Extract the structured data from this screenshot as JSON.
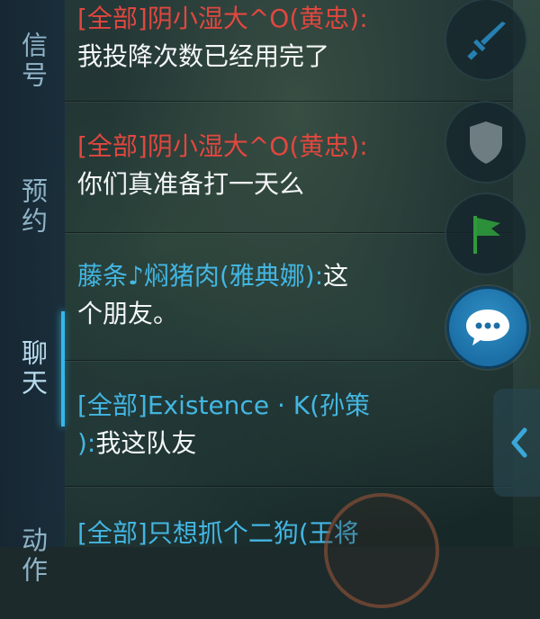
{
  "tabs": [
    {
      "label": "信号",
      "active": false
    },
    {
      "label": "预约",
      "active": false
    },
    {
      "label": "聊天",
      "active": true
    },
    {
      "label": "动作",
      "active": false
    }
  ],
  "messages": [
    {
      "lines": [
        [
          {
            "text": "[全部]阴小湿大^O(黄忠):",
            "color": "red"
          }
        ],
        [
          {
            "text": "我投降次数已经用完了",
            "color": "white"
          }
        ]
      ]
    },
    {
      "lines": [
        [
          {
            "text": "[全部]阴小湿大^O(黄忠):",
            "color": "red"
          }
        ],
        [
          {
            "text": "你们真准备打一天么",
            "color": "white"
          }
        ]
      ]
    },
    {
      "lines": [
        [
          {
            "text": "藤条♪焖猪肉(雅典娜):",
            "color": "cyan"
          },
          {
            "text": "这",
            "color": "white"
          }
        ],
        [
          {
            "text": "个朋友。",
            "color": "white"
          }
        ]
      ]
    },
    {
      "lines": [
        [
          {
            "text": "[全部]Existence · K(孙策",
            "color": "cyan"
          }
        ],
        [
          {
            "text": "):",
            "color": "cyan"
          },
          {
            "text": "我这队友",
            "color": "white"
          }
        ]
      ]
    },
    {
      "lines": [
        [
          {
            "text": "[全部]只想抓个二狗(王将",
            "color": "cyan"
          }
        ]
      ]
    }
  ],
  "side_buttons": [
    {
      "name": "attack-signal-button",
      "icon": "sword-icon",
      "color": "#2a8fc8"
    },
    {
      "name": "retreat-signal-button",
      "icon": "shield-icon",
      "color": "#7c8c92"
    },
    {
      "name": "gather-signal-button",
      "icon": "flag-icon",
      "color": "#2f9a3c"
    }
  ],
  "chat_button": {
    "icon": "chat-bubble-icon"
  },
  "collapse_button": {
    "icon": "chevron-left-icon"
  }
}
